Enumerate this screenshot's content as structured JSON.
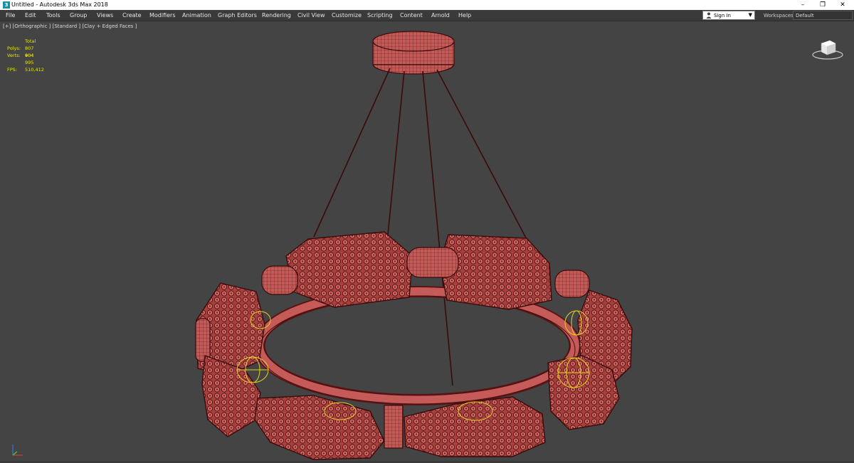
{
  "window": {
    "title": "Untitled - Autodesk 3ds Max 2018",
    "icon": "3ds-max-app-icon",
    "controls": {
      "minimize": "–",
      "maximize": "❐",
      "close": "✕"
    }
  },
  "menu": {
    "items": [
      "File",
      "Edit",
      "Tools",
      "Group",
      "Views",
      "Create",
      "Modifiers",
      "Animation",
      "Graph Editors",
      "Rendering",
      "Civil View",
      "Customize",
      "Scripting",
      "Content",
      "Arnold",
      "Help"
    ],
    "signin_label": "Sign In",
    "workspaces_label": "Workspaces:",
    "workspaces_value": "Default"
  },
  "viewport": {
    "label": "[+] [Orthographic ] [Standard ] [Clay + Edged Faces ]",
    "stats": {
      "header": "Total",
      "polys_label": "Polys:",
      "polys_value": "807 904",
      "verts_label": "Verts:",
      "verts_value": "404 995",
      "fps_label": "FPS:",
      "fps_value": "510,412"
    },
    "colors": {
      "background": "#444444",
      "mesh_fill": "#c0504f",
      "mesh_edge": "#4a0f0f",
      "light_helper": "#e6d21e",
      "stats_text": "#e8e800"
    }
  }
}
